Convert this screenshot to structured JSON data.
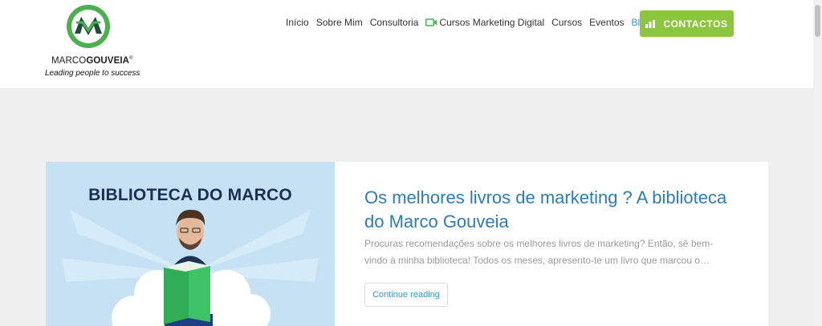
{
  "brand": {
    "name_light": "MARCO",
    "name_bold": "GOUVEIA",
    "reg_mark": "®",
    "tagline": "Leading people to success"
  },
  "nav": {
    "items": [
      "Início",
      "Sobre Mim",
      "Consultoria",
      "Cursos Marketing Digital",
      "Cursos",
      "Eventos",
      "Blog"
    ],
    "active": "Blog",
    "contact_label": "CONTACTOS"
  },
  "colors": {
    "accent_green": "#8cc63f",
    "link_blue": "#3a95d6",
    "logo_green": "#4caf50"
  },
  "post": {
    "thumbnail_title": "BIBLIOTECA DO MARCO",
    "title": "Os melhores livros de marketing ? A biblioteca do Marco Gouveia",
    "excerpt": "Procuras recomendações sobre os melhores livros de marketing? Então, sê bem-vindo à minha biblioteca! Todos os meses, apresento-te um livro que marcou o…",
    "continue_label": "Continue reading"
  }
}
